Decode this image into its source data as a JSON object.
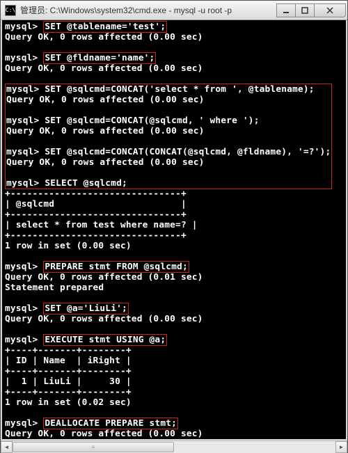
{
  "window": {
    "title": "管理员: C:\\Windows\\system32\\cmd.exe - mysql  -u root -p",
    "app_icon_text": "C:\\"
  },
  "session": {
    "prompt": "mysql>",
    "blocks": [
      {
        "cmd": "SET @tablename='test';",
        "result": "Query OK, 0 rows affected (0.00 sec)",
        "highlight": true
      },
      {
        "cmd": "SET @fldname='name';",
        "result": "Query OK, 0 rows affected (0.00 sec)",
        "highlight": true
      },
      {
        "cmd": "SET @sqlcmd=CONCAT('select * from ', @tablename);",
        "result": "Query OK, 0 rows affected (0.00 sec)",
        "highlight": false,
        "group": "big"
      },
      {
        "cmd": "SET @sqlcmd=CONCAT(@sqlcmd, ' where ');",
        "result": "Query OK, 0 rows affected (0.00 sec)",
        "highlight": false,
        "group": "big"
      },
      {
        "cmd": "SET @sqlcmd=CONCAT(CONCAT(@sqlcmd, @fldname), '=?');",
        "result": "Query OK, 0 rows affected (0.00 sec)",
        "highlight": false,
        "group": "big"
      },
      {
        "cmd": "SELECT @sqlcmd;",
        "result": null,
        "highlight": false,
        "group": "big"
      }
    ],
    "sqlcmd_table": {
      "border": "+-------------------------------+",
      "header": "| @sqlcmd                       |",
      "row": "| select * from test where name=? |",
      "footer": "1 row in set (0.00 sec)"
    },
    "blocks2": [
      {
        "cmd": "PREPARE stmt FROM @sqlcmd;",
        "result": "Query OK, 0 rows affected (0.01 sec)\nStatement prepared",
        "highlight": true
      },
      {
        "cmd": "SET @a='LiuLi';",
        "result": "Query OK, 0 rows affected (0.00 sec)",
        "highlight": true
      },
      {
        "cmd": "EXECUTE stmt USING @a;",
        "result": null,
        "highlight": true
      }
    ],
    "result_table": {
      "border": "+----+-------+--------+",
      "header": "| ID | Name  | iRight |",
      "row": "|  1 | LiuLi |     30 |",
      "footer": "1 row in set (0.02 sec)"
    },
    "blocks3": [
      {
        "cmd": "DEALLOCATE PREPARE stmt;",
        "result": "Query OK, 0 rows affected (0.00 sec)",
        "highlight": true
      }
    ]
  },
  "chart_data": {
    "type": "table",
    "tables": [
      {
        "title": "@sqlcmd",
        "columns": [
          "@sqlcmd"
        ],
        "rows": [
          [
            "select * from test where name=?"
          ]
        ],
        "row_count_text": "1 row in set (0.00 sec)"
      },
      {
        "title": "EXECUTE stmt USING @a",
        "columns": [
          "ID",
          "Name",
          "iRight"
        ],
        "rows": [
          [
            1,
            "LiuLi",
            30
          ]
        ],
        "row_count_text": "1 row in set (0.02 sec)"
      }
    ]
  }
}
